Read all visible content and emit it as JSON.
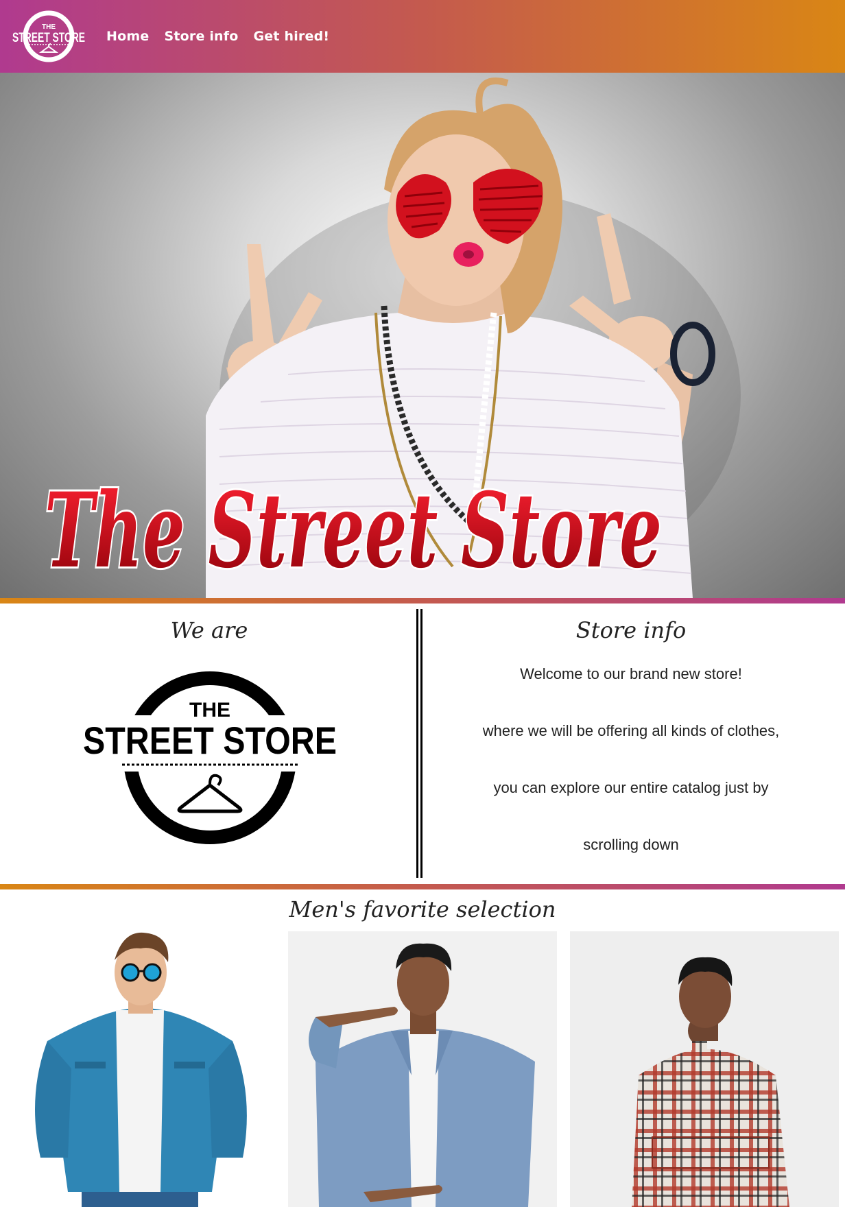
{
  "header": {
    "logo_alt": "THE STREET STORE",
    "logo_small_the": "THE",
    "logo_small_name": "STREET STORE",
    "nav": [
      {
        "label": "Home"
      },
      {
        "label": "Store info"
      },
      {
        "label": "Get hired!"
      }
    ],
    "gradient_colors": [
      "#b03a8f",
      "#d98615"
    ]
  },
  "hero": {
    "title": "The Street Store",
    "title_color": "#c4000f"
  },
  "about": {
    "heading": "We are",
    "logo_the": "THE",
    "logo_name": "STREET STORE"
  },
  "store_info": {
    "heading": "Store info",
    "lines": [
      "Welcome to our brand new store!",
      "where we will be offering all kinds of clothes,",
      "you can explore our entire catalog just by",
      "scrolling down"
    ]
  },
  "mens": {
    "heading": "Men's favorite selection",
    "products": [
      {
        "name": "denim-shirt-model",
        "icon": "product-photo"
      },
      {
        "name": "denim-jacket-model",
        "icon": "product-photo"
      },
      {
        "name": "plaid-shirt-model",
        "icon": "product-photo"
      }
    ]
  }
}
